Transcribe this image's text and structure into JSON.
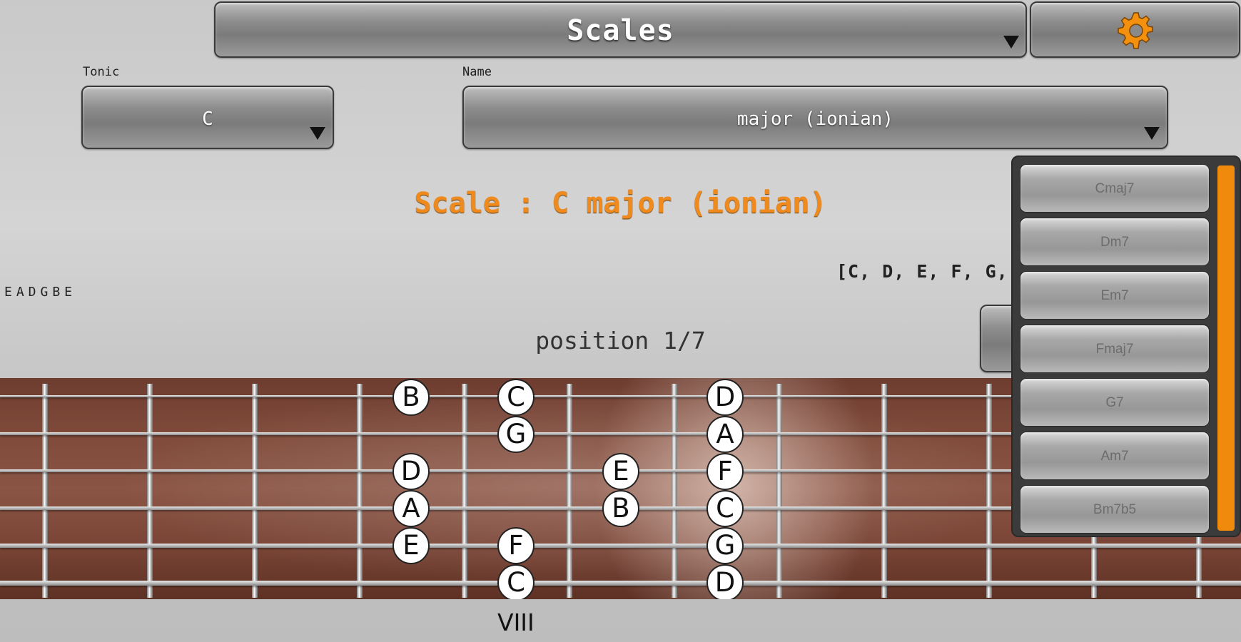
{
  "header": {
    "mode_label": "Scales"
  },
  "settings": {
    "icon": "gear-icon",
    "icon_color": "#f3900d"
  },
  "tonic": {
    "label": "Tonic",
    "value": "C"
  },
  "name": {
    "label": "Name",
    "value": "major (ionian)"
  },
  "scale_title": "Scale : C major (ionian)",
  "scale_notes": "[C, D, E, F, G, A",
  "tuning": "EADGBE",
  "position": "position 1/7",
  "fret_label": "VIII",
  "accent_color": "#ee8a1e",
  "chords": [
    "Cmaj7",
    "Dm7",
    "Em7",
    "Fmaj7",
    "G7",
    "Am7",
    "Bm7b5"
  ],
  "notes": {
    "string1": [
      "B",
      "C",
      "D"
    ],
    "string2": [
      "G",
      "A"
    ],
    "string3": [
      "D",
      "E",
      "F"
    ],
    "string4": [
      "A",
      "B",
      "C"
    ],
    "string5": [
      "E",
      "F",
      "G"
    ],
    "string6": [
      "C",
      "D"
    ]
  }
}
